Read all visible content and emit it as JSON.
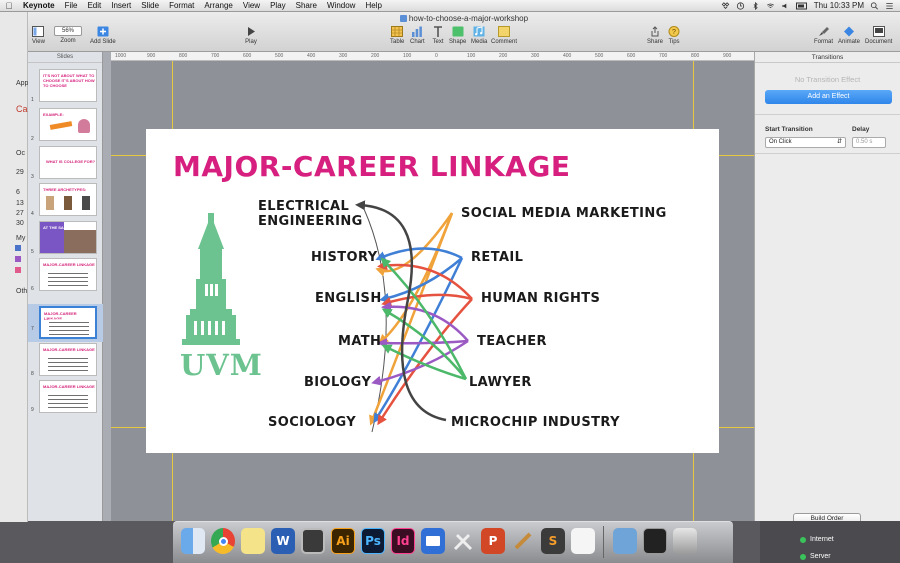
{
  "menubar": {
    "app": "Keynote",
    "items": [
      "File",
      "Edit",
      "Insert",
      "Slide",
      "Format",
      "Arrange",
      "View",
      "Play",
      "Share",
      "Window",
      "Help"
    ],
    "clock": "Thu 10:33 PM"
  },
  "window": {
    "title": "how-to-choose-a-major-workshop"
  },
  "toolbar": {
    "view": "View",
    "zoom_value": "56%",
    "zoom": "Zoom",
    "add_slide": "Add Slide",
    "play": "Play",
    "table": "Table",
    "chart": "Chart",
    "text": "Text",
    "shape": "Shape",
    "media": "Media",
    "comment": "Comment",
    "share": "Share",
    "tips": "Tips",
    "format": "Format",
    "animate": "Animate",
    "document": "Document"
  },
  "ruler_ticks": [
    "1000",
    "900",
    "800",
    "700",
    "600",
    "500",
    "400",
    "300",
    "200",
    "100",
    "0",
    "100",
    "200",
    "300",
    "400",
    "500",
    "600",
    "700",
    "800",
    "900"
  ],
  "navigator": {
    "heading": "Slides",
    "slides": [
      {
        "num": "1",
        "title": "IT'S NOT ABOUT WHAT TO CHOOSE IT'S ABOUT HOW TO CHOOSE"
      },
      {
        "num": "2",
        "title": "EXAMPLE:"
      },
      {
        "num": "3",
        "title": "WHAT IS COLLEGE FOR?"
      },
      {
        "num": "4",
        "title": "THREE ARCHETYPES:"
      },
      {
        "num": "5",
        "title": "AT THE SAME"
      },
      {
        "num": "6",
        "title": "MAJOR-CAREER LINKAGE"
      },
      {
        "num": "7",
        "title": "MAJOR-CAREER LINKAGE"
      },
      {
        "num": "8",
        "title": "MAJOR-CAREER LINKAGE"
      },
      {
        "num": "9",
        "title": "MAJOR-CAREER LINKAGE"
      }
    ],
    "selected": "7"
  },
  "slide": {
    "title": "MAJOR-CAREER LINKAGE",
    "logo_text": "UVM",
    "majors": [
      "ELECTRICAL",
      "ENGINEERING",
      "HISTORY",
      "ENGLISH",
      "MATH",
      "BIOLOGY",
      "SOCIOLOGY"
    ],
    "careers": [
      "SOCIAL MEDIA MARKETING",
      "RETAIL",
      "HUMAN RIGHTS",
      "TEACHER",
      "LAWYER",
      "MICROCHIP INDUSTRY"
    ],
    "colors": {
      "title": "#d61f7e",
      "logo": "#6cc390",
      "orange": "#f0a33a",
      "blue": "#3f7fd6",
      "red": "#e5523f",
      "purple": "#9b59c4",
      "green": "#4cb86a",
      "dark": "#444444"
    }
  },
  "inspector": {
    "heading": "Transitions",
    "no_effect": "No Transition Effect",
    "add_effect": "Add an Effect",
    "start_label": "Start Transition",
    "start_value": "On Click",
    "delay_label": "Delay",
    "delay_value": "0.50 s",
    "build_order": "Build Order"
  },
  "desktop": {
    "left_labels": [
      "App",
      "Ca",
      "Oc",
      "29",
      "6",
      "13",
      "27",
      "30",
      "My",
      "Oth"
    ],
    "right_labels": [
      "Internet",
      "Server"
    ]
  },
  "dock": {
    "items": [
      "finder-icon",
      "chrome-icon",
      "stickies-icon",
      "word-icon",
      "photo-booth-icon",
      "illustrator-icon",
      "photoshop-icon",
      "indesign-icon",
      "keynote-icon",
      "utilities-icon",
      "powerpoint-icon",
      "script-editor-icon",
      "sublime-icon",
      "text-edit-icon",
      "downloads-icon",
      "terminal-icon",
      "trash-icon"
    ],
    "labels": {
      "word": "W",
      "illustrator": "Ai",
      "photoshop": "Ps",
      "indesign": "Id",
      "powerpoint": "P",
      "sublime": "S"
    }
  }
}
